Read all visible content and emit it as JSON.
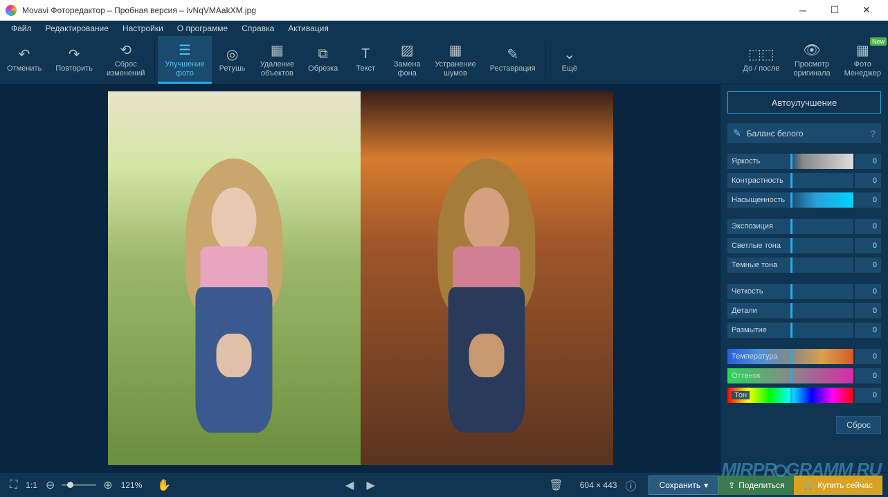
{
  "window": {
    "title": "Movavi Фоторедактор – Пробная версия – IvNqVMAakXM.jpg"
  },
  "menu": {
    "items": [
      "Файл",
      "Редактирование",
      "Настройки",
      "О программе",
      "Справка",
      "Активация"
    ]
  },
  "toolbar": {
    "undo": "Отменить",
    "redo": "Повторить",
    "reset": "Сброс\nизменений",
    "enhance": "Улучшение\nфото",
    "retouch": "Ретушь",
    "remove": "Удаление\nобъектов",
    "crop": "Обрезка",
    "text": "Текст",
    "bgswap": "Замена\nфона",
    "denoise": "Устранение\nшумов",
    "restore": "Реставрация",
    "more": "Ещё",
    "beforeafter": "До / после",
    "vieworig": "Просмотр\nоригинала",
    "manager": "Фото\nМенеджер",
    "new_badge": "New"
  },
  "panel": {
    "auto": "Автоулучшение",
    "wb": "Баланс белого",
    "help": "?",
    "sliders": {
      "brightness": {
        "label": "Яркость",
        "value": "0"
      },
      "contrast": {
        "label": "Контрастность",
        "value": "0"
      },
      "saturation": {
        "label": "Насыщенность",
        "value": "0"
      },
      "exposure": {
        "label": "Экспозиция",
        "value": "0"
      },
      "highlights": {
        "label": "Светлые тона",
        "value": "0"
      },
      "shadows": {
        "label": "Темные тона",
        "value": "0"
      },
      "sharpness": {
        "label": "Четкость",
        "value": "0"
      },
      "details": {
        "label": "Детали",
        "value": "0"
      },
      "blur": {
        "label": "Размытие",
        "value": "0"
      },
      "temperature": {
        "label": "Температура",
        "value": "0"
      },
      "tint": {
        "label": "Оттенок",
        "value": "0"
      },
      "hue": {
        "label": "Тон",
        "value": "0"
      }
    },
    "reset": "Сброс"
  },
  "bottom": {
    "ratio": "1:1",
    "zoom": "121%",
    "dimensions": "604 × 443",
    "save": "Сохранить",
    "share": "Поделиться",
    "buy": "Купить сейчас"
  },
  "watermark": "MIRPROGRAMM.RU"
}
